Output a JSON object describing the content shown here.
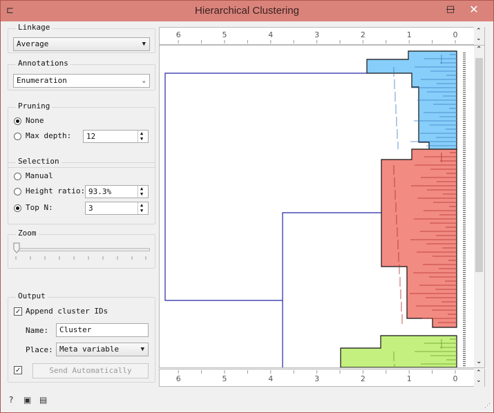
{
  "window": {
    "title": "Hierarchical Clustering",
    "controls": {
      "minimize": "—",
      "maximize": "□",
      "close": "✕"
    }
  },
  "linkage": {
    "label": "Linkage",
    "value": "Average"
  },
  "annotations": {
    "label": "Annotations",
    "value": "Enumeration"
  },
  "pruning": {
    "label": "Pruning",
    "none_label": "None",
    "max_depth_label": "Max depth:",
    "max_depth_value": "12",
    "selected": "None"
  },
  "selection": {
    "label": "Selection",
    "manual_label": "Manual",
    "height_ratio_label": "Height ratio:",
    "height_ratio_value": "93.3%",
    "top_n_label": "Top N:",
    "top_n_value": "3",
    "selected": "Top N"
  },
  "zoom": {
    "label": "Zoom",
    "level": 0
  },
  "output": {
    "label": "Output",
    "append_label": "Append cluster IDs",
    "append_checked": true,
    "name_label": "Name:",
    "name_value": "Cluster",
    "place_label": "Place:",
    "place_value": "Meta variable",
    "send_auto_checked": true,
    "send_label": "Send Automatically"
  },
  "axis": {
    "ticks": [
      "6",
      "5",
      "4",
      "3",
      "2",
      "1",
      "0"
    ]
  },
  "clusters": [
    {
      "name": "blue",
      "fill": "#87cefa",
      "stroke": "#3a7dbf",
      "rows": 40
    },
    {
      "name": "red",
      "fill": "#f28b82",
      "stroke": "#b0302a",
      "rows": 75
    },
    {
      "name": "green",
      "fill": "#c3f07f",
      "stroke": "#6a9a2a",
      "rows": 15
    }
  ],
  "colors": {
    "titlebar": "#d9837b",
    "tree_line": "#2323a5"
  }
}
